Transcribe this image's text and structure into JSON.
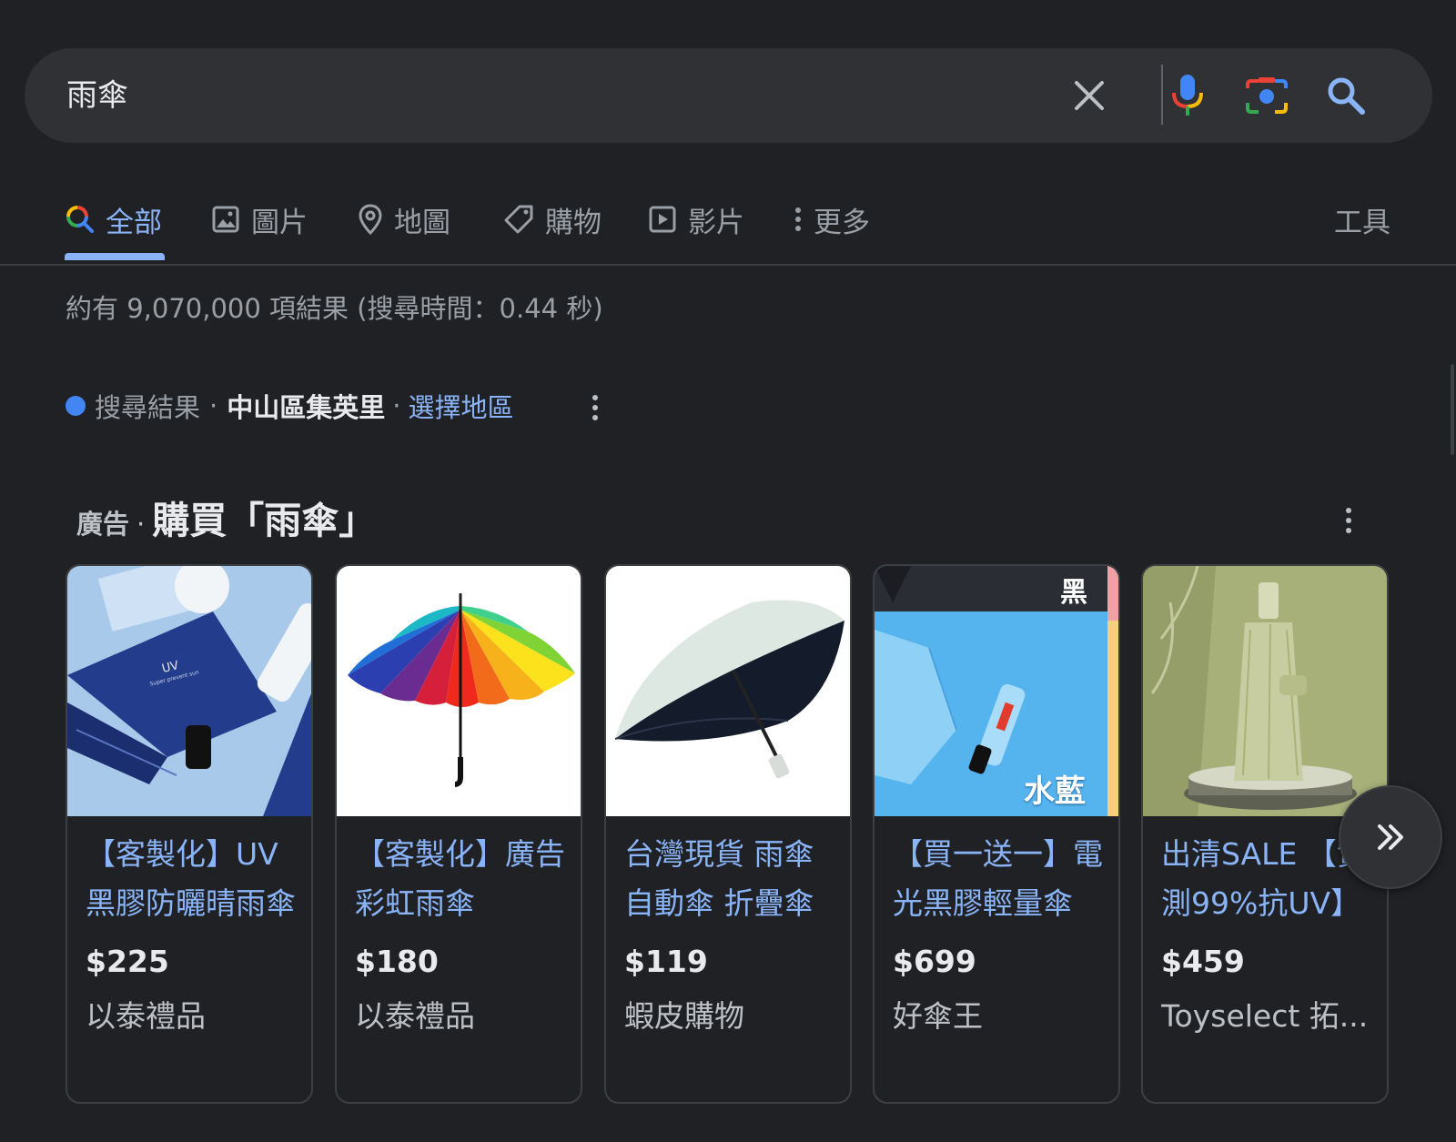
{
  "search": {
    "query": "雨傘"
  },
  "tabs": [
    {
      "label": "全部",
      "active": true
    },
    {
      "label": "圖片"
    },
    {
      "label": "地圖"
    },
    {
      "label": "購物"
    },
    {
      "label": "影片"
    },
    {
      "label": "更多"
    }
  ],
  "tools_label": "工具",
  "stats": "約有 9,070,000 項結果 (搜尋時間：0.44 秒)",
  "location": {
    "prefix": "搜尋結果",
    "sep": "·",
    "place": "中山區集英里",
    "link": "選擇地區"
  },
  "ads": {
    "tag": "廣告",
    "sep": "·",
    "title": "購買「雨傘」",
    "products": [
      {
        "title": "【客製化】UV 黑膠防曬晴雨傘",
        "price": "$225",
        "seller": "以泰禮品"
      },
      {
        "title": "【客製化】廣告彩虹雨傘",
        "price": "$180",
        "seller": "以泰禮品"
      },
      {
        "title": "台灣現貨 雨傘 自動傘 折疊傘",
        "price": "$119",
        "seller": "蝦皮購物"
      },
      {
        "title": "【買一送一】電光黑膠輕量傘",
        "price": "$699",
        "seller": "好傘王"
      },
      {
        "title": "出清SALE 【實測99%抗UV】",
        "price": "$459",
        "seller": "Toyselect 拓..."
      }
    ],
    "image_labels": {
      "p1_mark": "UV",
      "p1_sub": "Super prevent sun",
      "p4_top": "黑",
      "p4_bottom": "水藍"
    }
  },
  "colors": {
    "background": "#202124",
    "link": "#8ab4f8",
    "accent_blue": "#4285f4"
  }
}
